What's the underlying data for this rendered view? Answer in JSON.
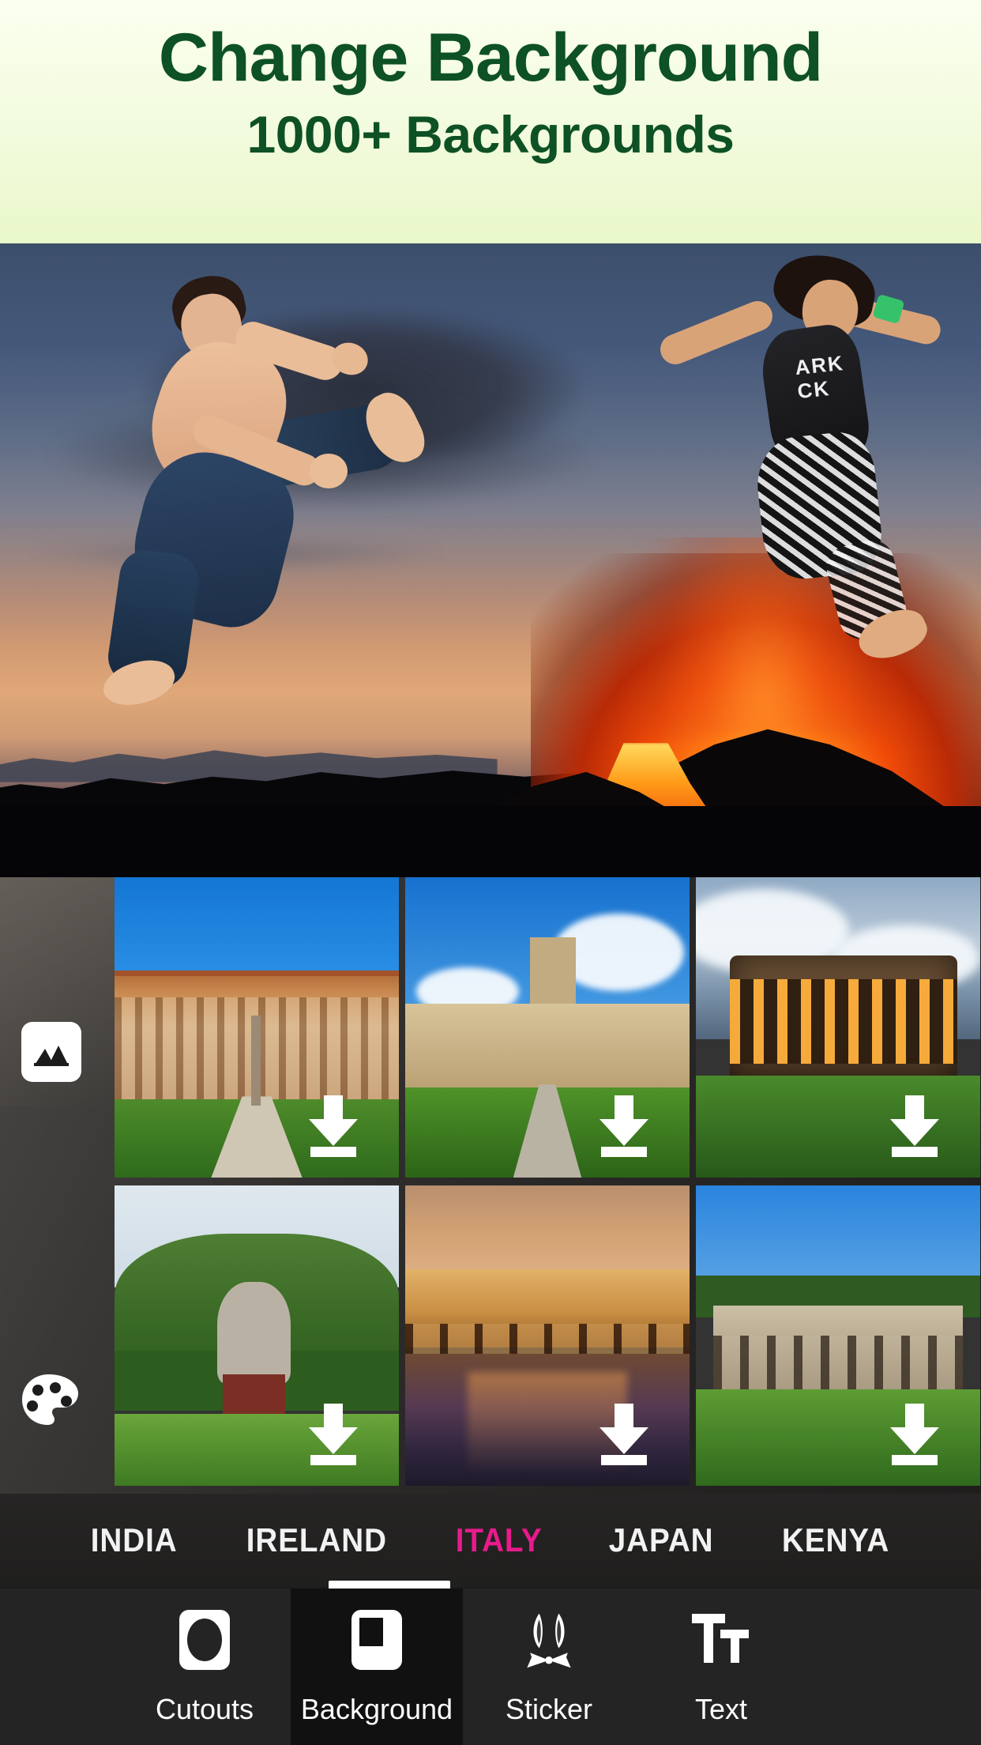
{
  "promo": {
    "title": "Change Background",
    "subtitle": "1000+ Backgrounds",
    "title_color": "#0d5124",
    "bg_color": "#f2fbdd"
  },
  "canvas": {
    "name": "photo-editor-canvas",
    "description": "Two jumping people composited over an erupting volcano at dusk"
  },
  "side_tools": [
    {
      "id": "gallery",
      "icon": "image-icon",
      "label": "Gallery"
    },
    {
      "id": "color",
      "icon": "palette-icon",
      "label": "Color"
    }
  ],
  "gallery": {
    "download_icon": "download-arrow-icon",
    "thumbnails": [
      {
        "id": "t1",
        "name": "pitti-palace",
        "download": true
      },
      {
        "id": "t2",
        "name": "sforza-castle",
        "download": true
      },
      {
        "id": "t3",
        "name": "colosseum",
        "download": true
      },
      {
        "id": "t4",
        "name": "garden-statue",
        "download": true
      },
      {
        "id": "t5",
        "name": "ponte-vecchio",
        "download": true
      },
      {
        "id": "t6",
        "name": "roman-forum",
        "download": true
      }
    ]
  },
  "tabs": {
    "items": [
      {
        "label": "INDIA",
        "active": false
      },
      {
        "label": "IRELAND",
        "active": false
      },
      {
        "label": "ITALY",
        "active": true
      },
      {
        "label": "JAPAN",
        "active": false
      },
      {
        "label": "KENYA",
        "active": false
      }
    ],
    "active_color": "#e81a8c",
    "inactive_color": "#f2f2f2"
  },
  "toolbar": {
    "items": [
      {
        "label": "Cutouts",
        "icon": "cutout-icon",
        "selected": false
      },
      {
        "label": "Background",
        "icon": "background-icon",
        "selected": true
      },
      {
        "label": "Sticker",
        "icon": "sticker-icon",
        "selected": false
      },
      {
        "label": "Text",
        "icon": "text-icon",
        "selected": false
      }
    ]
  },
  "overlay_text": {
    "shirt_line1": "ARK",
    "shirt_line2": "CK"
  }
}
